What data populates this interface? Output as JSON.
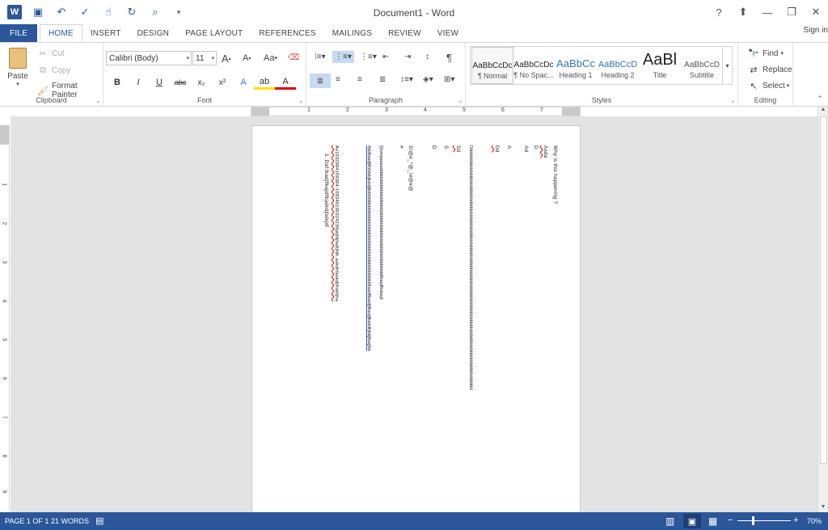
{
  "app": {
    "title": "Document1 - Word"
  },
  "qat": {
    "items": [
      {
        "icon": "word-logo-icon",
        "glyph": "W"
      },
      {
        "icon": "save-icon",
        "glyph": "💾"
      },
      {
        "icon": "undo-icon",
        "glyph": "↶"
      },
      {
        "icon": "spelling-icon",
        "glyph": "✓"
      },
      {
        "icon": "touch-mode-icon",
        "glyph": "☝"
      },
      {
        "icon": "redo-icon",
        "glyph": "↻"
      },
      {
        "icon": "print-preview-icon",
        "glyph": "🔍"
      },
      {
        "icon": "customize-qat-icon",
        "glyph": "▾"
      }
    ]
  },
  "window_controls": {
    "help": "?",
    "ribbon_options": "⬆",
    "minimize": "—",
    "restore": "❐",
    "close": "✕"
  },
  "tabs": [
    "FILE",
    "HOME",
    "INSERT",
    "DESIGN",
    "PAGE LAYOUT",
    "REFERENCES",
    "MAILINGS",
    "REVIEW",
    "VIEW"
  ],
  "active_tab": "HOME",
  "signin": "Sign in",
  "ribbon": {
    "clipboard": {
      "label": "Clipboard",
      "paste": "Paste",
      "cut": "Cut",
      "copy": "Copy",
      "format_painter": "Format Painter"
    },
    "font": {
      "label": "Font",
      "font_name": "Calibri (Body)",
      "font_size": "11",
      "grow": "A",
      "shrink": "A",
      "change_case": "Aa",
      "bold": "B",
      "italic": "I",
      "underline": "U",
      "strike": "abc",
      "sub": "x₂",
      "sup": "x²"
    },
    "paragraph": {
      "label": "Paragraph",
      "show_marks": "¶"
    },
    "styles": {
      "label": "Styles",
      "items": [
        {
          "preview": "AaBbCcDc",
          "name": "¶ Normal"
        },
        {
          "preview": "AaBbCcDc",
          "name": "¶ No Spac..."
        },
        {
          "preview": "AaBbCc",
          "name": "Heading 1"
        },
        {
          "preview": "AaBbCcD",
          "name": "Heading 2"
        },
        {
          "preview": "AaBl",
          "name": "Title"
        },
        {
          "preview": "AaBbCcD",
          "name": "Subtitle"
        }
      ]
    },
    "editing": {
      "label": "Editing",
      "find": "Find",
      "replace": "Replace",
      "select": "Select"
    }
  },
  "ruler": {
    "h_marks": [
      "1",
      "2",
      "3",
      "4",
      "5",
      "6",
      "7"
    ],
    "v_marks": [
      "1",
      "2",
      "3",
      "4",
      "5",
      "6",
      "7",
      "8",
      "9"
    ]
  },
  "document": {
    "lines": [
      {
        "text": "Why is this happening ?",
        "style": "red-tail"
      },
      {
        "text": "Asda",
        "style": "red"
      },
      {
        "text": "D",
        "style": ""
      },
      {
        "text": "Ad",
        "style": ""
      },
      {
        "text": "A",
        "style": ""
      },
      {
        "text": "Dd",
        "style": "red"
      },
      {
        "text": "Ddddddddddddddddddddddddddddddddddddddddddddddddddddddddddddddddddddddddddddddddddddddddddddddd",
        "style": ""
      },
      {
        "text": "Sd",
        "style": "red"
      },
      {
        "text": "S",
        "style": ""
      },
      {
        "text": "D",
        "style": ""
      },
      {
        "text": "S!@#_*@_!#@#@",
        "style": ""
      },
      {
        "text": "#",
        "style": ""
      },
      {
        "text": "Qweqaaaaddddddddddddddddddddddddddddddddddddddddddfkasjflkdasjf.",
        "style": ""
      },
      {
        "text": "Adsfkasdjfkhhdskjkasdjkldddddddddddddddddddddddddddddddddddddddddhasdflkasdjflkasdjfkadsfkjldsjlkasjfda",
        "style": "blue"
      },
      {
        "text": "As1032984109384-10934819032423lfjaljfdjfadljfdh askdhfaskdjfhdsfjha",
        "style": "red-tail2"
      },
      {
        "text": "1.    Daf;lkadjflkajdflkjalkdjfalkjdf",
        "style": ""
      }
    ]
  },
  "status": {
    "page": "PAGE 1 OF 1",
    "words": "21 WORDS",
    "zoom": "70%"
  }
}
